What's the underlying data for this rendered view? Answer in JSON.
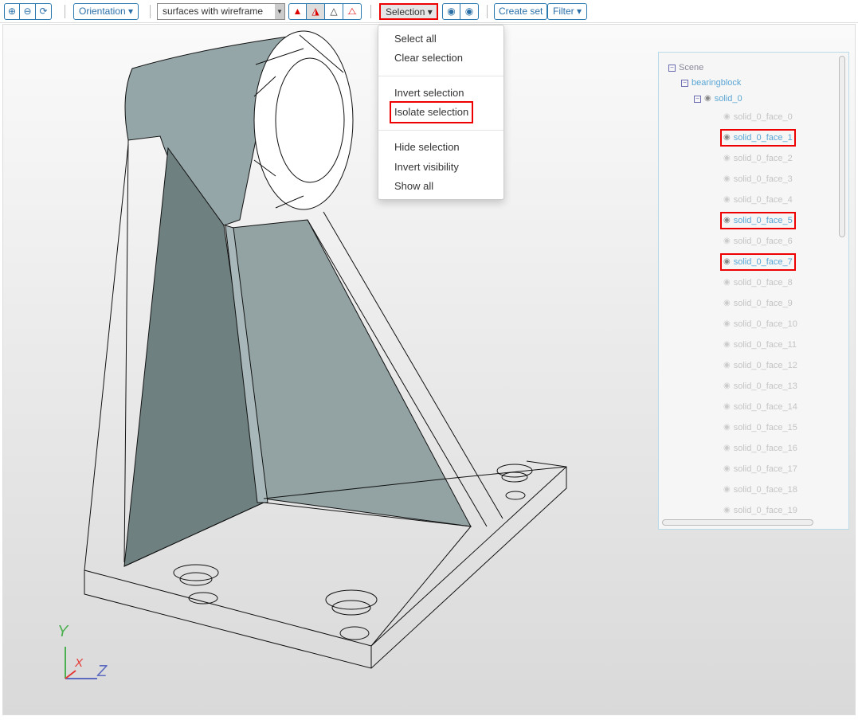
{
  "toolbar": {
    "zoom_in_icon": "zoom-in-icon",
    "zoom_out_icon": "zoom-out-icon",
    "refresh_icon": "refresh-icon",
    "orientation_label": "Orientation ▾",
    "render_mode": "surfaces with wireframe",
    "selection_label": "Selection ▾",
    "create_set_label": "Create set",
    "filter_label": "Filter ▾"
  },
  "selection_menu": {
    "items": [
      "Select all",
      "Clear selection",
      "Invert selection",
      "Isolate selection",
      "Hide selection",
      "Invert visibility",
      "Show all"
    ],
    "highlighted": "Isolate selection"
  },
  "tree": {
    "scene": "Scene",
    "model": "bearingblock",
    "solid": "solid_0",
    "faces": [
      "solid_0_face_0",
      "solid_0_face_1",
      "solid_0_face_2",
      "solid_0_face_3",
      "solid_0_face_4",
      "solid_0_face_5",
      "solid_0_face_6",
      "solid_0_face_7",
      "solid_0_face_8",
      "solid_0_face_9",
      "solid_0_face_10",
      "solid_0_face_11",
      "solid_0_face_12",
      "solid_0_face_13",
      "solid_0_face_14",
      "solid_0_face_15",
      "solid_0_face_16",
      "solid_0_face_17",
      "solid_0_face_18",
      "solid_0_face_19"
    ],
    "visible_faces": [
      1,
      5,
      7
    ]
  },
  "axes": {
    "y": "Y",
    "x": "X",
    "z": "Z",
    "colors": {
      "y": "#4caf50",
      "x": "#e53935",
      "z": "#5c6bc0"
    }
  },
  "colors": {
    "accent": "#2a7ab0",
    "highlight": "#e00000"
  }
}
